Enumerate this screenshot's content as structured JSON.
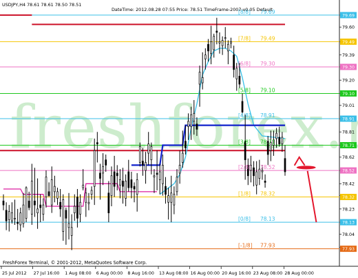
{
  "header": {
    "symbol_line": "USDJPY,H4  78.61 78.61 78.50 78.51",
    "info_line": "DateTime: 2012.08.28 07:55    Price: 78.51    TimeFrame-2007-v0.05    Default"
  },
  "watermark": "freshforex.ru",
  "footer": {
    "terminal": "FreshForex Terminal, © 2001-2012, MetaQuotes Software Corp."
  },
  "colors": {
    "background": "#ffffff",
    "candles": "#000000",
    "murrey_8_8": "#3bbfe8",
    "murrey_7_8": "#f5c400",
    "murrey_6_8": "#ee72c3",
    "murrey_5_8": "#1ec81e",
    "murrey_4_8": "#3bbfe8",
    "murrey_3_8": "#1ec81e",
    "murrey_2_8": "#ee72c3",
    "murrey_1_8": "#f5c400",
    "murrey_0_8": "#3bbfe8",
    "murrey_m1_8": "#e56b17",
    "resistance_line": "#cc1128",
    "trend_blue": "#1021cc",
    "trend_cyan": "#36c0e8",
    "trend_magenta": "#dc1fa0",
    "arrow": "#e3162c",
    "watermark": "#bde6bd"
  },
  "chart_data": {
    "type": "candlestick",
    "symbol": "USDJPY",
    "timeframe": "H4",
    "y_range": [
      77.85,
      79.7
    ],
    "price_ticks": [
      "79.69",
      "79.60",
      "79.49",
      "79.39",
      "79.30",
      "79.20",
      "79.10",
      "79.01",
      "78.91",
      "78.81",
      "78.71",
      "78.62",
      "78.52",
      "78.42",
      "78.33",
      "78.23",
      "78.13",
      "78.04",
      "77.94"
    ],
    "time_labels": [
      "25 Jul 2012",
      "27 Jul 16:00",
      "1 Aug 08:00",
      "6 Aug 00:00",
      "8 Aug 16:00",
      "13 Aug 08:00",
      "16 Aug 00:00",
      "20 Aug 16:00",
      "23 Aug 08:00",
      "28 Aug 00:00"
    ],
    "murrey_levels": [
      {
        "label": "[8/8]",
        "value": "79.69",
        "price": 79.69,
        "color_key": "murrey_8_8"
      },
      {
        "label": "[7/8]",
        "value": "79.49",
        "price": 79.49,
        "color_key": "murrey_7_8"
      },
      {
        "label": "[6/8]",
        "value": "79.30",
        "price": 79.3,
        "color_key": "murrey_6_8"
      },
      {
        "label": "[5/8]",
        "value": "79.10",
        "price": 79.1,
        "color_key": "murrey_5_8"
      },
      {
        "label": "[4/8]",
        "value": "78.91",
        "price": 78.91,
        "color_key": "murrey_4_8"
      },
      {
        "label": "[3/8]",
        "value": "78.71",
        "price": 78.71,
        "color_key": "murrey_3_8"
      },
      {
        "label": "[2/8]",
        "value": "78.52",
        "price": 78.52,
        "color_key": "murrey_2_8"
      },
      {
        "label": "[1/8]",
        "value": "78.32",
        "price": 78.32,
        "color_key": "murrey_1_8"
      },
      {
        "label": "[0/8]",
        "value": "78.13",
        "price": 78.13,
        "color_key": "murrey_0_8"
      },
      {
        "label": "[-1/8]",
        "value": "77.93",
        "price": 77.93,
        "color_key": "murrey_m1_8"
      }
    ],
    "highlighted_prices": [
      {
        "value": "79.69",
        "color_key": "murrey_8_8"
      },
      {
        "value": "79.49",
        "color_key": "murrey_7_8"
      },
      {
        "value": "79.30",
        "color_key": "murrey_6_8"
      },
      {
        "value": "79.10",
        "color_key": "murrey_5_8"
      },
      {
        "value": "78.91",
        "color_key": "murrey_4_8"
      },
      {
        "value": "78.71",
        "color_key": "murrey_3_8"
      },
      {
        "value": "78.52",
        "color_key": "murrey_2_8"
      },
      {
        "value": "78.32",
        "color_key": "murrey_1_8"
      },
      {
        "value": "78.13",
        "color_key": "murrey_0_8"
      },
      {
        "value": "77.93",
        "color_key": "murrey_m1_8"
      }
    ],
    "resistance_lines": [
      {
        "from_bar": 0,
        "to_bar": 10,
        "price": 79.69
      },
      {
        "from_bar": 10,
        "to_bar": 114,
        "price": 79.62
      },
      {
        "from_bar": 0,
        "to_bar": 114,
        "price": 78.67
      },
      {
        "from_bar": 85,
        "to_bar": 114,
        "price": 78.86
      }
    ],
    "candles": [
      [
        78.29,
        78.34,
        78.22,
        78.26
      ],
      [
        78.22,
        78.28,
        78.07,
        78.14
      ],
      [
        78.15,
        78.26,
        78.06,
        78.21
      ],
      [
        78.14,
        78.28,
        78.12,
        78.2
      ],
      [
        78.16,
        78.3,
        78.11,
        78.16
      ],
      [
        78.13,
        78.23,
        78.07,
        78.12
      ],
      [
        78.11,
        78.24,
        78.06,
        78.2
      ],
      [
        78.12,
        78.35,
        78.09,
        78.26
      ],
      [
        78.16,
        78.4,
        78.13,
        78.39
      ],
      [
        78.29,
        78.36,
        78.22,
        78.24
      ],
      [
        78.19,
        78.57,
        78.11,
        78.44
      ],
      [
        78.29,
        78.54,
        78.17,
        78.26
      ],
      [
        78.2,
        78.46,
        78.08,
        78.23
      ],
      [
        78.26,
        78.34,
        78.13,
        78.24
      ],
      [
        78.19,
        78.31,
        78.14,
        78.26
      ],
      [
        78.32,
        78.52,
        78.24,
        78.47
      ],
      [
        78.36,
        78.43,
        78.32,
        78.33
      ],
      [
        78.26,
        78.55,
        78.2,
        78.45
      ],
      [
        78.36,
        78.48,
        78.28,
        78.4
      ],
      [
        78.31,
        78.39,
        78.26,
        78.36
      ],
      [
        78.28,
        78.38,
        78.17,
        78.23
      ],
      [
        78.06,
        78.34,
        77.99,
        78.3
      ],
      [
        78.22,
        78.24,
        77.96,
        78.16
      ],
      [
        78.09,
        78.35,
        78.0,
        78.12
      ],
      [
        78.03,
        78.19,
        77.92,
        78.09
      ],
      [
        78.2,
        78.34,
        78.14,
        78.25
      ],
      [
        78.32,
        78.38,
        78.09,
        78.16
      ],
      [
        78.19,
        78.34,
        78.13,
        78.28
      ],
      [
        78.39,
        78.53,
        78.37,
        78.41
      ],
      [
        78.28,
        78.39,
        78.17,
        78.35
      ],
      [
        78.27,
        78.35,
        78.22,
        78.28
      ],
      [
        78.34,
        78.4,
        78.3,
        78.37
      ],
      [
        78.4,
        78.76,
        78.26,
        78.67
      ],
      [
        78.73,
        78.81,
        78.58,
        78.72
      ],
      [
        78.5,
        78.57,
        78.3,
        78.46
      ],
      [
        78.5,
        78.65,
        78.41,
        78.55
      ],
      [
        78.6,
        78.64,
        78.51,
        78.56
      ],
      [
        78.35,
        78.44,
        78.13,
        78.2
      ],
      [
        78.33,
        78.55,
        78.25,
        78.48
      ],
      [
        78.51,
        78.63,
        78.32,
        78.4
      ],
      [
        78.5,
        78.56,
        78.37,
        78.48
      ],
      [
        78.41,
        78.53,
        78.31,
        78.45
      ],
      [
        78.44,
        78.54,
        78.27,
        78.4
      ],
      [
        78.31,
        78.49,
        78.25,
        78.44
      ],
      [
        78.51,
        78.6,
        78.36,
        78.39
      ],
      [
        78.45,
        78.51,
        78.31,
        78.39
      ],
      [
        78.4,
        78.43,
        78.28,
        78.38
      ],
      [
        78.34,
        78.5,
        78.21,
        78.45
      ],
      [
        78.58,
        78.73,
        78.55,
        78.7
      ],
      [
        78.59,
        78.69,
        78.48,
        78.56
      ],
      [
        78.52,
        78.66,
        78.42,
        78.58
      ],
      [
        78.65,
        78.81,
        78.56,
        78.72
      ],
      [
        78.6,
        78.73,
        78.49,
        78.7
      ],
      [
        78.47,
        78.53,
        78.35,
        78.48
      ],
      [
        78.5,
        78.67,
        78.37,
        78.49
      ],
      [
        78.45,
        78.57,
        78.34,
        78.51
      ],
      [
        78.42,
        78.64,
        78.33,
        78.56
      ],
      [
        78.4,
        78.47,
        78.27,
        78.34
      ],
      [
        78.28,
        78.39,
        78.15,
        78.33
      ],
      [
        78.28,
        78.48,
        78.13,
        78.35
      ],
      [
        78.26,
        78.4,
        78.19,
        78.34
      ],
      [
        78.36,
        78.53,
        78.33,
        78.47
      ],
      [
        78.5,
        78.67,
        78.42,
        78.56
      ],
      [
        78.58,
        78.82,
        78.54,
        78.65
      ],
      [
        78.74,
        78.86,
        78.64,
        78.69
      ],
      [
        78.85,
        78.95,
        78.75,
        78.89
      ],
      [
        78.85,
        79.0,
        78.75,
        78.94
      ],
      [
        78.89,
        79.05,
        78.79,
        78.95
      ],
      [
        78.87,
        78.92,
        78.78,
        78.83
      ],
      [
        79.17,
        79.31,
        79.0,
        79.26
      ],
      [
        79.18,
        79.41,
        79.13,
        79.22
      ],
      [
        79.36,
        79.44,
        79.28,
        79.39
      ],
      [
        79.47,
        79.51,
        79.34,
        79.42
      ],
      [
        79.4,
        79.61,
        79.32,
        79.49
      ],
      [
        79.43,
        79.55,
        79.37,
        79.53
      ],
      [
        79.57,
        79.67,
        79.47,
        79.56
      ],
      [
        79.48,
        79.56,
        79.4,
        79.49
      ],
      [
        79.46,
        79.53,
        79.39,
        79.5
      ],
      [
        79.52,
        79.6,
        79.44,
        79.52
      ],
      [
        79.42,
        79.5,
        79.32,
        79.47
      ],
      [
        79.48,
        79.52,
        79.44,
        79.49
      ],
      [
        79.39,
        79.46,
        79.22,
        79.28
      ],
      [
        79.21,
        79.33,
        79.12,
        79.29
      ],
      [
        79.23,
        79.33,
        79.14,
        79.17
      ],
      [
        79.04,
        79.1,
        78.93,
        78.96
      ],
      [
        78.74,
        78.94,
        78.45,
        78.6
      ],
      [
        78.56,
        78.61,
        78.41,
        78.48
      ],
      [
        78.52,
        78.63,
        78.43,
        78.56
      ],
      [
        78.54,
        78.59,
        78.4,
        78.48
      ],
      [
        78.41,
        78.59,
        78.34,
        78.51
      ],
      [
        78.46,
        78.6,
        78.41,
        78.53
      ],
      [
        78.51,
        78.56,
        78.45,
        78.52
      ],
      [
        78.44,
        78.49,
        78.39,
        78.43
      ],
      [
        78.74,
        78.78,
        78.56,
        78.64
      ],
      [
        78.67,
        78.82,
        78.59,
        78.73
      ],
      [
        78.71,
        78.82,
        78.63,
        78.75
      ],
      [
        78.76,
        78.84,
        78.69,
        78.8
      ],
      [
        78.77,
        78.85,
        78.7,
        78.72
      ],
      [
        78.72,
        78.81,
        78.66,
        78.77
      ],
      [
        78.61,
        78.71,
        78.48,
        78.51
      ]
    ],
    "indicator_lines": [
      {
        "name": "",
        "color_key": "trend_magenta",
        "points": [
          [
            0,
            78.38
          ],
          [
            6,
            78.38
          ],
          [
            7,
            78.34
          ],
          [
            14,
            78.34
          ],
          [
            15,
            78.25
          ],
          [
            28,
            78.25
          ],
          [
            29,
            78.42
          ],
          [
            40,
            78.42
          ],
          [
            41,
            78.36
          ],
          [
            54,
            78.36
          ]
        ]
      },
      {
        "name": "",
        "color_key": "trend_cyan",
        "points": [
          [
            55,
            78.34
          ],
          [
            60,
            78.42
          ],
          [
            62,
            78.49
          ],
          [
            64,
            78.62
          ],
          [
            66,
            78.84
          ],
          [
            68,
            79.02
          ],
          [
            70,
            79.24
          ],
          [
            72,
            79.34
          ],
          [
            74,
            79.42
          ],
          [
            76,
            79.44
          ],
          [
            78,
            79.44
          ],
          [
            80,
            79.42
          ],
          [
            82,
            79.38
          ],
          [
            84,
            79.22
          ],
          [
            86,
            79.02
          ],
          [
            88,
            78.86
          ],
          [
            91,
            78.78
          ],
          [
            99,
            78.76
          ]
        ]
      },
      {
        "name": "",
        "color_key": "trend_blue",
        "points": [
          [
            45,
            78.56
          ],
          [
            55,
            78.56
          ],
          [
            56,
            78.71
          ],
          [
            63,
            78.71
          ],
          [
            64,
            78.86
          ],
          [
            99,
            78.86
          ]
        ]
      }
    ],
    "annotation_arrow": {
      "from_bar": 104,
      "to_bar": 110,
      "from_price": 78.62,
      "to_price": 78.13
    }
  }
}
